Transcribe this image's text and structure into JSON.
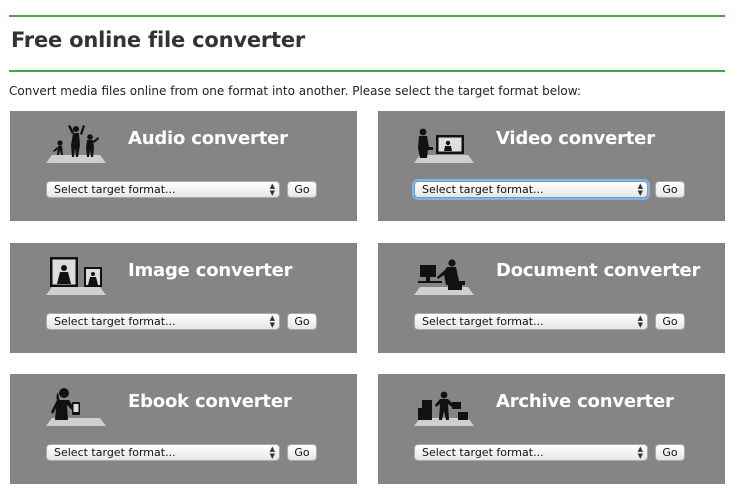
{
  "page": {
    "title": "Free online file converter",
    "intro": "Convert media files online from one format into another. Please select the target format below:"
  },
  "colors": {
    "accent_rule": "#43a843",
    "card_bg": "#858585",
    "card_title": "#ffffff"
  },
  "converters": [
    {
      "title": "Audio converter",
      "icon": "dancers-icon",
      "select_placeholder": "Select target format...",
      "go_label": "Go"
    },
    {
      "title": "Video converter",
      "icon": "video-viewer-icon",
      "select_placeholder": "Select target format...",
      "go_label": "Go"
    },
    {
      "title": "Image converter",
      "icon": "picture-frames-icon",
      "select_placeholder": "Select target format...",
      "go_label": "Go"
    },
    {
      "title": "Document converter",
      "icon": "person-at-computer-icon",
      "select_placeholder": "Select target format...",
      "go_label": "Go"
    },
    {
      "title": "Ebook converter",
      "icon": "reader-icon",
      "select_placeholder": "Select target format...",
      "go_label": "Go"
    },
    {
      "title": "Archive converter",
      "icon": "box-stack-icon",
      "select_placeholder": "Select target format...",
      "go_label": "Go"
    }
  ]
}
